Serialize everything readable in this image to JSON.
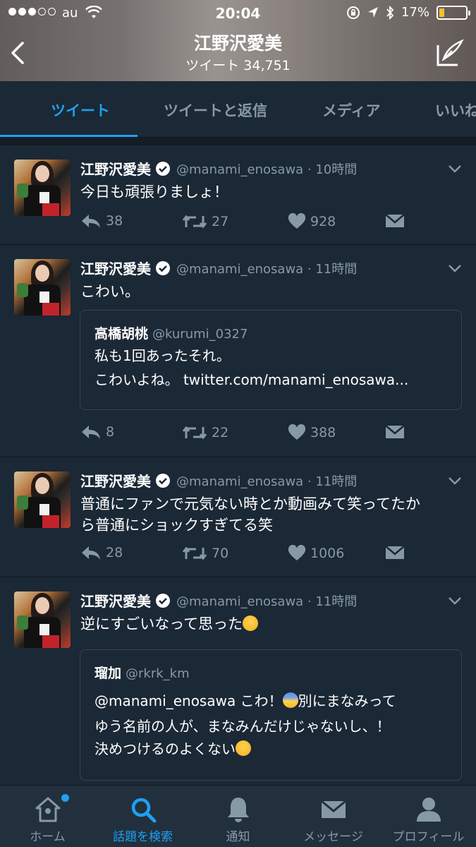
{
  "status_bar": {
    "carrier": "au",
    "time": "20:04",
    "battery": "17%",
    "battery_level": 0.17
  },
  "header": {
    "title": "江野沢愛美",
    "subtitle": "ツイート 34,751"
  },
  "tabs": [
    {
      "label": "ツイート",
      "active": true
    },
    {
      "label": "ツイートと返信",
      "active": false
    },
    {
      "label": "メディア",
      "active": false
    },
    {
      "label": "いいね",
      "active": false
    }
  ],
  "tweets": [
    {
      "name": "江野沢愛美",
      "handle": "@manami_enosawa · 10時間",
      "text_lines": [
        "今日も頑張りましょ！"
      ],
      "reply_count": "38",
      "retweet_count": "27",
      "like_count": "928"
    },
    {
      "name": "江野沢愛美",
      "handle": "@manami_enosawa · 11時間",
      "text_lines": [
        "こわい。"
      ],
      "quote": {
        "name": "高橋胡桃",
        "handle": "@kurumi_0327",
        "text_lines": [
          "私も1回あったそれ。",
          "こわいよね。 twitter.com/manami_enosawa..."
        ]
      },
      "reply_count": "8",
      "retweet_count": "22",
      "like_count": "388"
    },
    {
      "name": "江野沢愛美",
      "handle": "@manami_enosawa · 11時間",
      "text_lines": [
        "普通にファンで元気ない時とか動画みて笑ってたか",
        "ら普通にショックすぎてる笑"
      ],
      "reply_count": "28",
      "retweet_count": "70",
      "like_count": "1006"
    },
    {
      "name": "江野沢愛美",
      "handle": "@manami_enosawa · 11時間",
      "text_lines": [
        "逆にすごいなって思った"
      ],
      "quote": {
        "name": "瑠加",
        "handle": "@rkrk_km",
        "text_lines": [
          "@manami_enosawa こわ！",
          "別にまなみって",
          "ゆう名前の人が、まなみんだけじゃないし、！",
          "決めつけるのよくない"
        ]
      }
    }
  ],
  "bottom_tabs": [
    {
      "label": "ホーム",
      "icon": "home-icon"
    },
    {
      "label": "話題を検索",
      "icon": "search-icon",
      "active": true
    },
    {
      "label": "通知",
      "icon": "bell-icon"
    },
    {
      "label": "メッセージ",
      "icon": "message-icon"
    },
    {
      "label": "プロフィール",
      "icon": "profile-icon"
    }
  ],
  "colors": {
    "accent": "#1da1f2",
    "background": "#1b2836",
    "muted": "#8899a6"
  }
}
